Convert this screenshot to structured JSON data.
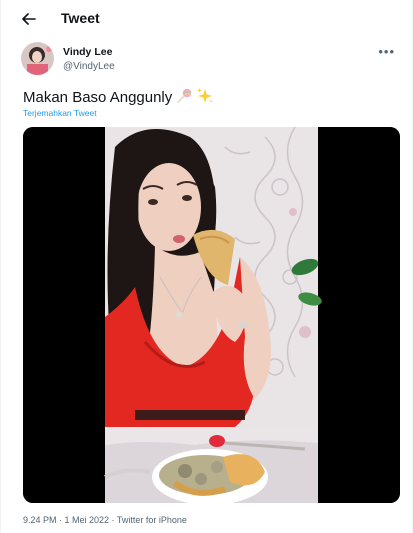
{
  "header": {
    "title": "Tweet"
  },
  "author": {
    "display_name": "Vindy Lee",
    "handle": "@VindyLee"
  },
  "tweet": {
    "text": "Makan Baso Anggunly",
    "emojis": [
      "lollipop-icon",
      "sparkles-icon"
    ],
    "translate_label": "Terjemahkan Tweet",
    "meta": "9.24 PM · 1 Mei 2022 · Twitter for iPhone"
  },
  "colors": {
    "link": "#1d9bf0",
    "muted": "#536471",
    "dress": "#e32822"
  }
}
